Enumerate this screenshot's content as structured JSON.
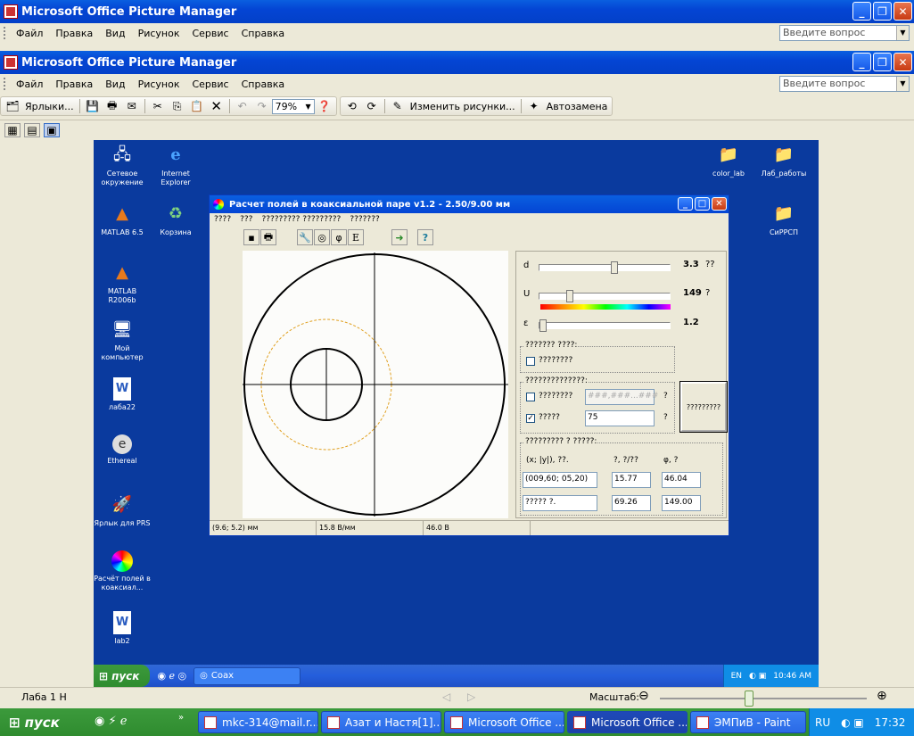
{
  "outer_window": {
    "title": "Microsoft Office Picture Manager",
    "menu": [
      "Файл",
      "Правка",
      "Вид",
      "Рисунок",
      "Сервис",
      "Справка"
    ],
    "help_placeholder": "Введите вопрос"
  },
  "inner_window": {
    "title": "Microsoft Office Picture Manager",
    "menu": [
      "Файл",
      "Правка",
      "Вид",
      "Рисунок",
      "Сервис",
      "Справка"
    ],
    "help_placeholder": "Введите вопрос",
    "toolbar": {
      "shortcuts_label": "Ярлыки...",
      "zoom_value": "79%",
      "edit_pictures_label": "Изменить рисунки...",
      "autocorrect_label": "Автозамена"
    }
  },
  "desktop_icons_left": [
    {
      "label": "Сетевое окружение",
      "icon": "network-icon"
    },
    {
      "label": "Internet Explorer",
      "icon": "ie-icon"
    },
    {
      "label": "MATLAB 6.5",
      "icon": "matlab-icon"
    },
    {
      "label": "Корзина",
      "icon": "recycle-bin-icon"
    },
    {
      "label": "MATLAB R2006b",
      "icon": "matlab-icon"
    },
    {
      "label": "Мой компьютер",
      "icon": "computer-icon"
    },
    {
      "label": "лаба22",
      "icon": "word-doc-icon"
    },
    {
      "label": "Ethereal",
      "icon": "ethereal-icon"
    },
    {
      "label": "Ярлык для PRS",
      "icon": "rocket-icon"
    },
    {
      "label": "Расчёт полей в коаксиал...",
      "icon": "coax-icon"
    },
    {
      "label": "lab2",
      "icon": "word-doc-icon"
    }
  ],
  "desktop_icons_right": [
    {
      "label": "color_lab",
      "icon": "folder-icon"
    },
    {
      "label": "Лаб_работы",
      "icon": "folder-icon"
    },
    {
      "label": "СиРРСП",
      "icon": "folder-icon"
    }
  ],
  "app": {
    "title": "Расчет полей в коаксиальной паре v1.2 - 2.50/9.00 мм",
    "menu": [
      "????",
      "???",
      "????????? ?????????",
      "???????"
    ],
    "toolbar_icons": [
      "save-icon",
      "print-icon",
      "wrench-icon",
      "circle-icon",
      "phi-icon",
      "e-icon",
      "export-icon",
      "help-icon"
    ],
    "sliders": [
      {
        "label": "d",
        "value": "3.3",
        "unit": "??",
        "position": 0.55
      },
      {
        "label": "U",
        "value": "149",
        "unit": "?",
        "position": 0.22
      },
      {
        "label": "ε",
        "value": "1.2",
        "unit": "",
        "position": 0.02
      }
    ],
    "group1": {
      "title": "??????? ????:",
      "checkbox_label": "????????",
      "checked": false
    },
    "group2": {
      "title": "??????????????:",
      "row1": {
        "label": "????????",
        "checked": false,
        "value": "###,###...###",
        "unit": "?"
      },
      "row2": {
        "label": "?????",
        "checked": true,
        "value": "75",
        "unit": "?"
      },
      "button_label": "?????????"
    },
    "group3": {
      "title": "????????? ? ?????:",
      "col1_header": "(x; |y|), ??.",
      "col2_header": "?, ?/??",
      "col3_header": "φ, ?",
      "row1": [
        "(009,60; 05,20)",
        "15.77",
        "46.04"
      ],
      "row2": [
        "????? ?.",
        "69.26",
        "149.00"
      ]
    },
    "status": [
      "(9.6; 5.2) мм",
      "15.8 В/мм",
      "46.0 В"
    ],
    "diagram_colors": {
      "outer": "#000000",
      "field_line": "#e0a020"
    }
  },
  "inner_taskbar": {
    "start": "пуск",
    "task": "Coax",
    "lang": "EN",
    "time": "10:46 AM"
  },
  "statusbar": {
    "left_text": "Лаба 1 Н",
    "zoom_label": "Масштаб:",
    "zoom_position": 0.43
  },
  "taskbar": {
    "start": "пуск",
    "tasks": [
      "mkc-314@mail.r...",
      "Азат и Настя[1]...",
      "Microsoft Office ...",
      "Microsoft Office ...",
      "ЭМПиВ - Paint"
    ],
    "lang": "RU",
    "time": "17:32"
  }
}
